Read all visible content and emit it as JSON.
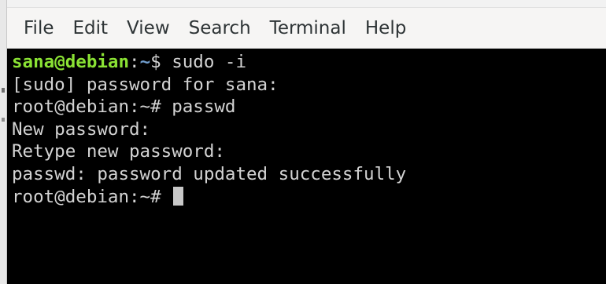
{
  "menubar": {
    "items": [
      "File",
      "Edit",
      "View",
      "Search",
      "Terminal",
      "Help"
    ]
  },
  "terminal": {
    "prompt_user_host": "sana@debian",
    "prompt_sep": ":",
    "prompt_path": "~",
    "prompt_symbol": "$",
    "first_command": " sudo -i",
    "lines": [
      "[sudo] password for sana:",
      "root@debian:~# passwd",
      "New password:",
      "Retype new password:",
      "passwd: password updated successfully"
    ],
    "final_prompt": "root@debian:~# "
  },
  "colors": {
    "terminal_bg": "#000000",
    "terminal_fg": "#d3d3d3",
    "user_host": "#8ae234",
    "path": "#729fcf",
    "menubar_bg": "#f6f5f4"
  }
}
